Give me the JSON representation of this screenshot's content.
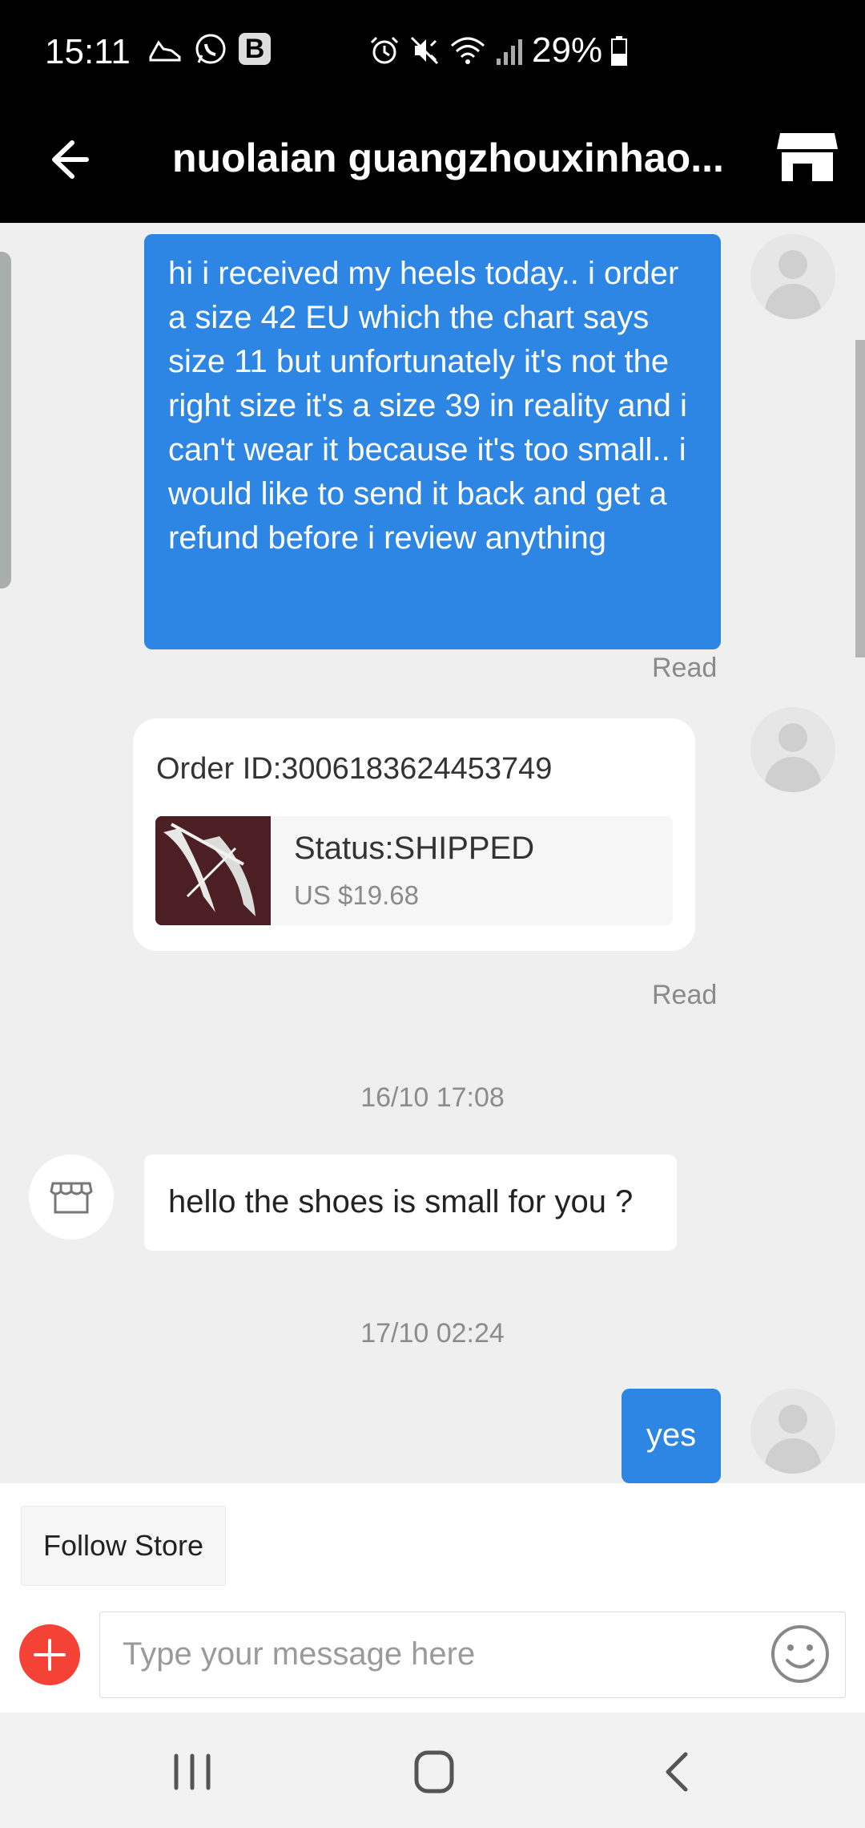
{
  "status_bar": {
    "time": "15:11",
    "battery": "29%",
    "icons": [
      "running-shoe-icon",
      "whatsapp-icon",
      "b-app-icon",
      "alarm-icon",
      "mute-icon",
      "wifi-icon",
      "signal-icon",
      "battery-icon"
    ],
    "b_badge": "B"
  },
  "header": {
    "title": "nuolaian guangzhouxinhao...",
    "back_icon": "arrow-left-icon",
    "store_icon": "store-icon"
  },
  "messages": {
    "m1": {
      "text": "hi i received my heels today.. i order a size 42 EU which the chart says size 11 but unfortunately it's not the right size it's a size 39 in reality and i can't wear it because it's too small.. i would like to send it back and get a refund before i review anything",
      "status": "Read"
    },
    "order": {
      "order_id": "Order ID:3006183624453749",
      "status": "Status:SHIPPED",
      "price": "US $19.68",
      "read": "Read"
    },
    "ts1": "16/10 17:08",
    "m2": {
      "text": "hello the shoes is small for you ?"
    },
    "ts2": "17/10 02:24",
    "m3": {
      "text": "yes"
    }
  },
  "input": {
    "follow_label": "Follow Store",
    "placeholder": "Type your message here"
  },
  "colors": {
    "outgoing_bubble": "#2d86e4",
    "plus_button": "#f44336"
  }
}
